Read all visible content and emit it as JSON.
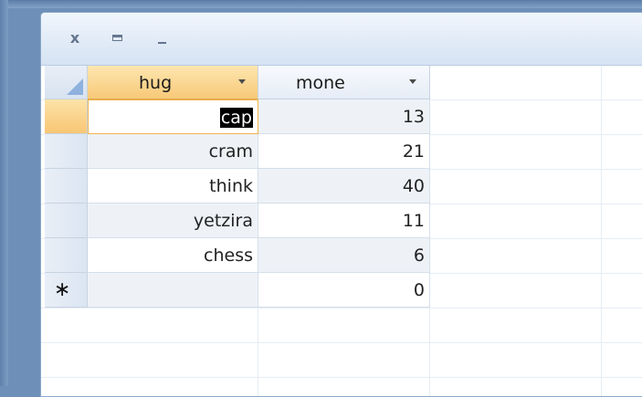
{
  "window": {
    "close_glyph": "x",
    "restore_glyph": "",
    "minimize_glyph": ""
  },
  "table": {
    "columns": [
      {
        "label": "hug"
      },
      {
        "label": "mone"
      }
    ],
    "rows": [
      {
        "hug": "cap",
        "mone": "13"
      },
      {
        "hug": "cram",
        "mone": "21"
      },
      {
        "hug": "think",
        "mone": "40"
      },
      {
        "hug": "yetzira",
        "mone": "11"
      },
      {
        "hug": "chess",
        "mone": "6"
      }
    ],
    "new_row": {
      "marker": "∗",
      "hug": "",
      "mone": "0"
    }
  },
  "colors": {
    "active_header": "#f8c978",
    "selection_highlight": "#000000"
  }
}
